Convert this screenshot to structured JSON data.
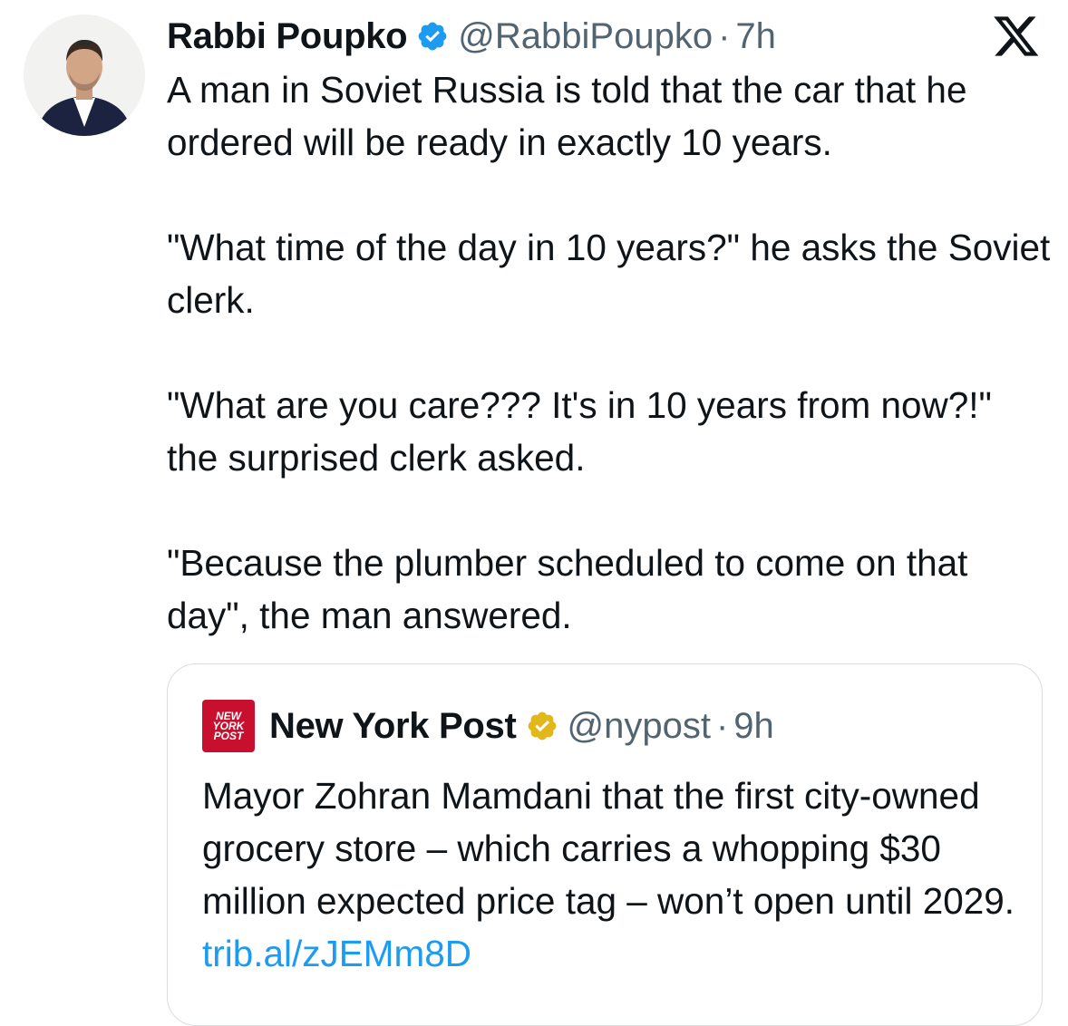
{
  "tweet": {
    "author_name": "Rabbi Poupko",
    "handle": "@RabbiPoupko",
    "separator": "·",
    "time": "7h",
    "verified_icon": "verified-badge-icon",
    "platform_icon": "x-logo-icon",
    "text_paragraphs": [
      "A man in Soviet Russia is told that the car that he ordered will be ready in exactly 10 years.",
      "\"What time of the day in 10 years?\" he asks the Soviet clerk.",
      "\"What are you care??? It's in 10 years from now?!\" the surprised clerk asked.",
      "\"Because the plumber scheduled to come on that day\", the man answered."
    ]
  },
  "quoted_tweet": {
    "logo_text": [
      "NEW",
      "YORK",
      "POST"
    ],
    "author_name": "New York Post",
    "handle": "@nypost",
    "separator": "·",
    "time": "9h",
    "verified_icon": "gold-verified-badge-icon",
    "text": "Mayor Zohran Mamdani that the first city-owned grocery store – which carries a whopping $30 million expected price tag – won’t open until 2029.",
    "link": "trib.al/zJEMm8D"
  },
  "colors": {
    "text": "#0f1419",
    "muted": "#536471",
    "link": "#1d9bf0",
    "verified_blue": "#1d9bf0",
    "verified_gold": "#e2b719",
    "nypost_red": "#c8102e"
  }
}
